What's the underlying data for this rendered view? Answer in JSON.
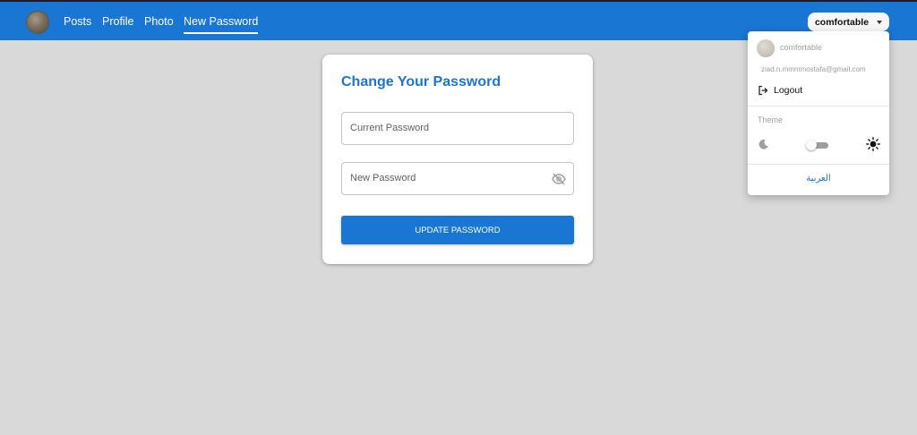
{
  "navbar": {
    "links": [
      {
        "label": "Posts"
      },
      {
        "label": "Profile"
      },
      {
        "label": "Photo"
      },
      {
        "label": "New Password",
        "active": true
      }
    ],
    "user_button": {
      "label": "comfortable",
      "icon": "caret-down-icon"
    }
  },
  "user_menu": {
    "username": "comfortable",
    "email": "ziad.n.mmmmostafa@gmail.com",
    "logout_label": "Logout",
    "theme_label": "Theme",
    "theme_mode": "light",
    "language_label": "العربية"
  },
  "form": {
    "title": "Change Your Password",
    "current_password_placeholder": "Current Password",
    "new_password_placeholder": "New Password",
    "submit_label": "UPDATE PASSWORD"
  },
  "colors": {
    "primary": "#1976d2",
    "background": "#d9d9d9",
    "card": "#ffffff"
  }
}
